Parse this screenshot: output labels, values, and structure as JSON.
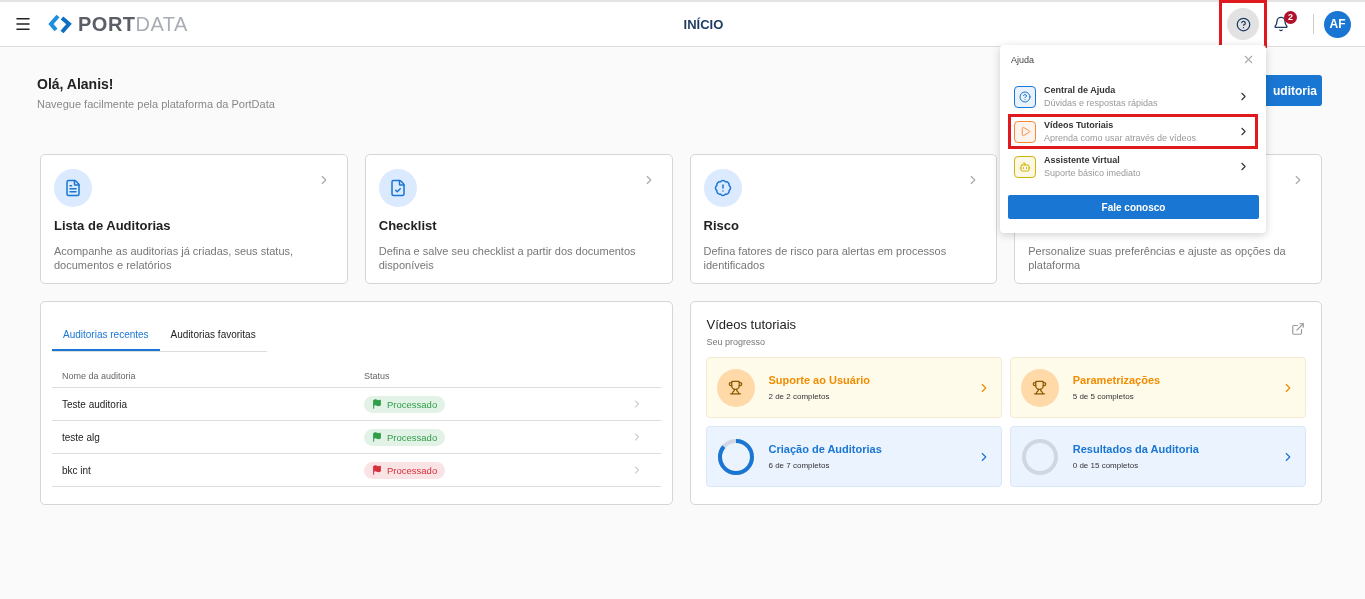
{
  "header": {
    "logo": {
      "strong": "PORT",
      "light": "DATA"
    },
    "title": "INÍCIO",
    "help_highlighted": true,
    "notifications": "2",
    "avatar": "AF"
  },
  "greeting": {
    "title": "Olá, Alanis!",
    "subtitle": "Navegue facilmente pela plataforma da PortData"
  },
  "new_button": "uditoria",
  "cards": [
    {
      "kind": "list",
      "title": "Lista de Auditorias",
      "description": "Acompanhe as auditorias já criadas, seus status, documentos e relatórios"
    },
    {
      "kind": "checklist",
      "title": "Checklist",
      "description": "Defina e salve seu checklist a partir dos documentos disponíveis"
    },
    {
      "kind": "risk",
      "title": "Risco",
      "description": "Defina fatores de risco para alertas em processos identificados"
    },
    {
      "kind": "settings",
      "description": "Personalize suas preferências e ajuste as opções da plataforma"
    }
  ],
  "audits": {
    "tabs": [
      {
        "label": "Auditorias recentes",
        "selected": true
      },
      {
        "label": "Auditorias favoritas",
        "selected": false
      }
    ],
    "columns": [
      "Nome da auditoria",
      "Status"
    ],
    "rows": [
      {
        "name": "Teste auditoria",
        "status": "Processado",
        "color": "#2e9e48"
      },
      {
        "name": "teste alg",
        "status": "Processado",
        "color": "#2e9e48"
      },
      {
        "name": "bkc int",
        "status": "Processado",
        "color": "#d6303c"
      }
    ]
  },
  "videos": {
    "title": "Vídeos tutoriais",
    "subtitle": "Seu progresso",
    "items": [
      {
        "kind": "complete",
        "title": "Suporte ao Usuário",
        "progress": "2 de 2 completos"
      },
      {
        "kind": "complete",
        "title": "Parametrizações",
        "progress": "5 de 5 completos"
      },
      {
        "kind": "progress",
        "title": "Criação de Auditorias",
        "progress": "6 de 7 completos",
        "level": 0.857
      },
      {
        "kind": "progress",
        "title": "Resultados da Auditoria",
        "progress": "0 de 15 completos",
        "level": 0
      }
    ]
  },
  "help_menu": {
    "title": "Ajuda",
    "items": [
      {
        "kind": "help",
        "title": "Central de Ajuda",
        "subtitle": "Dúvidas e respostas rápidas",
        "highlighted": false
      },
      {
        "kind": "video",
        "title": "Vídeos Tutoriais",
        "subtitle": "Aprenda como usar através de vídeos",
        "highlighted": true
      },
      {
        "kind": "assistant",
        "title": "Assistente Virtual",
        "subtitle": "Suporte básico imediato",
        "highlighted": false
      }
    ],
    "button": "Fale conosco"
  }
}
